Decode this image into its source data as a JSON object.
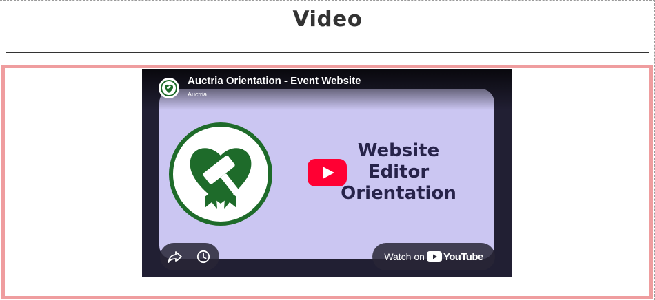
{
  "section": {
    "title": "Video"
  },
  "player": {
    "video_title": "Auctria Orientation - Event Website",
    "channel_name": "Auctria",
    "thumbnail": {
      "headline_line1": "Website",
      "headline_line2": "Editor",
      "headline_line3": "Orientation"
    },
    "watch_on": "Watch on",
    "youtube_word": "YouTube",
    "icons": {
      "avatar": "auctria-logo-icon",
      "play": "play-icon",
      "share": "share-icon",
      "watch_later": "clock-icon",
      "youtube": "youtube-logo-icon"
    }
  },
  "colors": {
    "frame_border": "#ef9d9f",
    "thumbnail_bg": "#cbc6f2",
    "logo_green": "#1e6b2a",
    "youtube_red": "#ff0033",
    "headline": "#27234a"
  }
}
